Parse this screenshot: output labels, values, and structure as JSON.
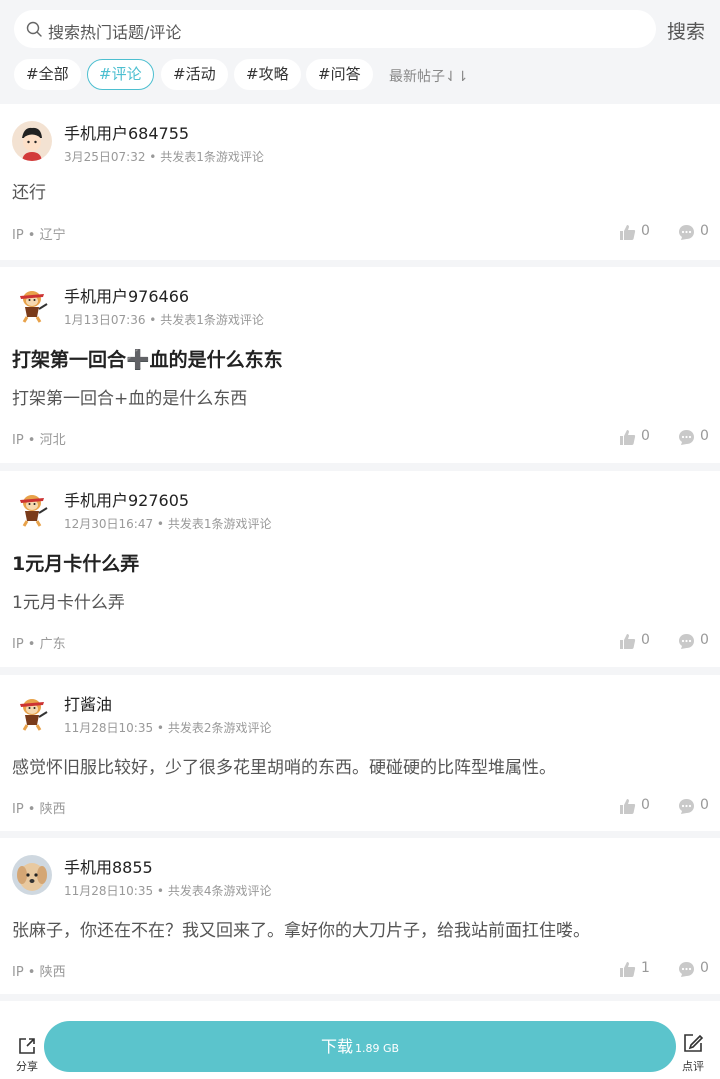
{
  "search": {
    "placeholder": "搜索热门话题/评论",
    "button_label": "搜索"
  },
  "filters": {
    "chips": [
      "#全部",
      "#评论",
      "#活动",
      "#攻略",
      "#问答"
    ],
    "active": "#评论",
    "sort_label": "最新帖子⇃⇂"
  },
  "posts": [
    {
      "username": "手机用户684755",
      "meta": "3月25日07:32 • 共发表1条游戏评论",
      "title": "",
      "body": "还行",
      "ip": "IP • 辽宁",
      "likes": "0",
      "comments": "0",
      "avatar": "boy-avatar-icon"
    },
    {
      "username": "手机用户976466",
      "meta": "1月13日07:36 • 共发表1条游戏评论",
      "title": "打架第一回合➕血的是什么东东",
      "body": "打架第一回合+血的是什么东西",
      "ip": "IP • 河北",
      "likes": "0",
      "comments": "0",
      "avatar": "monkey-avatar-icon"
    },
    {
      "username": "手机用户927605",
      "meta": "12月30日16:47 • 共发表1条游戏评论",
      "title": "1元月卡什么弄",
      "body": "1元月卡什么弄",
      "ip": "IP • 广东",
      "likes": "0",
      "comments": "0",
      "avatar": "monkey-avatar-icon"
    },
    {
      "username": "打酱油",
      "meta": "11月28日10:35 • 共发表2条游戏评论",
      "title": "",
      "body": "感觉怀旧服比较好，少了很多花里胡哨的东西。硬碰硬的比阵型堆属性。",
      "ip": "IP • 陕西",
      "likes": "0",
      "comments": "0",
      "avatar": "monkey-avatar-icon"
    },
    {
      "username": "手机用8855",
      "meta": "11月28日10:35 • 共发表4条游戏评论",
      "title": "",
      "body": "张麻子，你还在不在？我又回来了。拿好你的大刀片子，给我站前面扛住喽。",
      "ip": "IP • 陕西",
      "likes": "1",
      "comments": "0",
      "avatar": "dog-avatar-icon"
    }
  ],
  "bottom": {
    "share_label": "分享",
    "download_label": "下载",
    "download_size": "1.89 GB",
    "review_label": "点评"
  },
  "colors": {
    "accent": "#4dbfd0",
    "download": "#5bc4cc"
  }
}
